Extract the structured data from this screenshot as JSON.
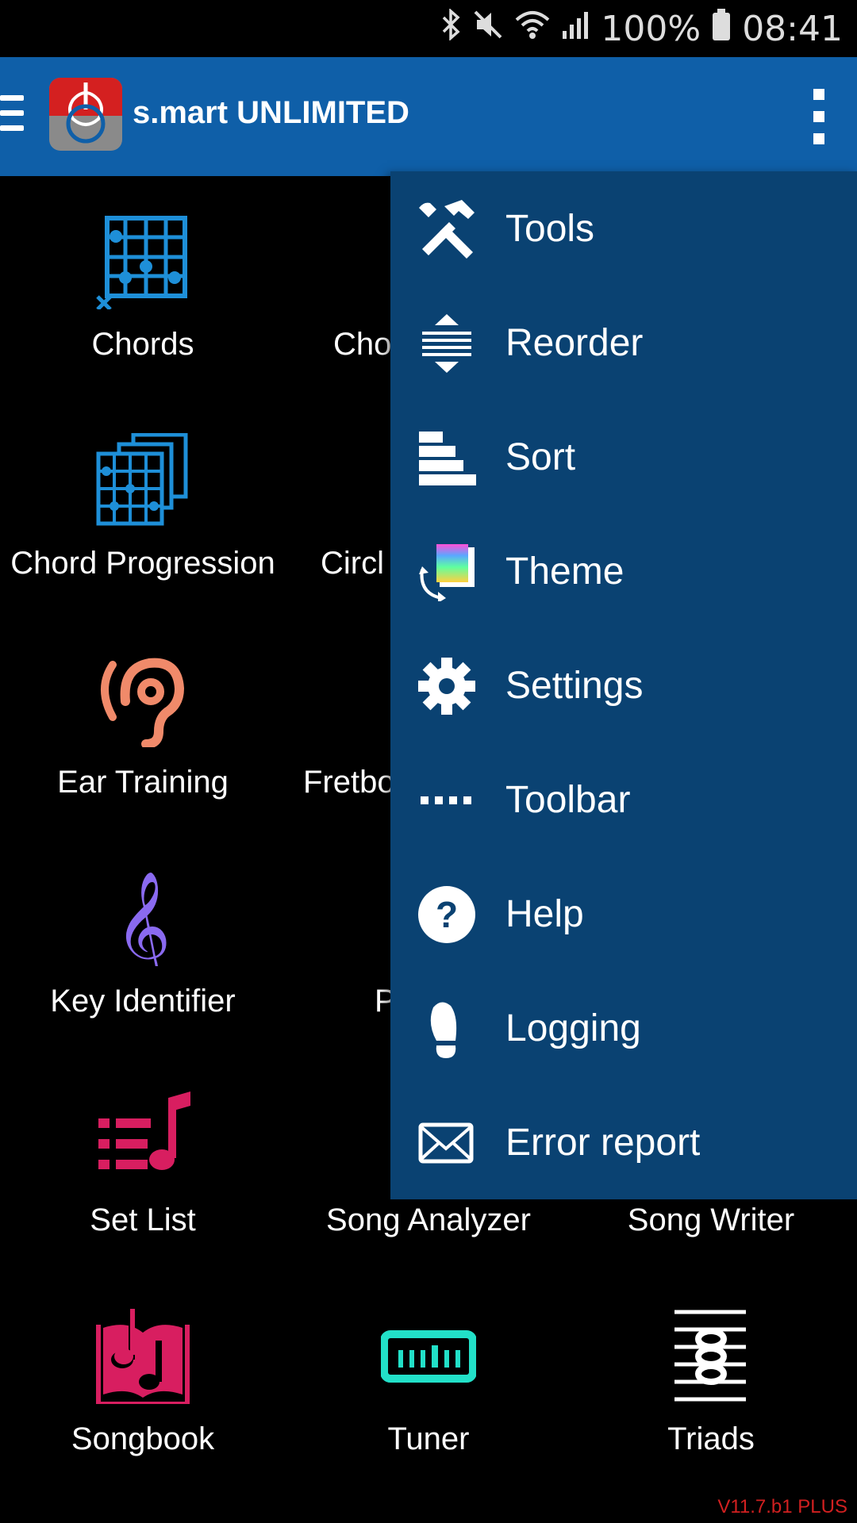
{
  "status_bar": {
    "battery": "100%",
    "time": "08:41",
    "icons": [
      "bluetooth-icon",
      "mute-icon",
      "wifi-icon",
      "signal-icon",
      "battery-icon"
    ]
  },
  "app_bar": {
    "title": "s.mart UNLIMITED",
    "brand_color": "#0f5fa8"
  },
  "tiles": [
    {
      "label": "Chords",
      "icon": "chord-grid-icon",
      "color": "#1e8fd8"
    },
    {
      "label": "Cho",
      "icon": "chord-grid-icon",
      "color": "#1e8fd8"
    },
    {
      "label": "",
      "icon": "",
      "color": ""
    },
    {
      "label": "Chord Progression",
      "icon": "chord-progression-icon",
      "color": "#1e8fd8"
    },
    {
      "label": "Circl",
      "icon": "circle-icon",
      "color": "#7a5ce0"
    },
    {
      "label": "",
      "icon": "",
      "color": ""
    },
    {
      "label": "Ear Training",
      "icon": "ear-icon",
      "color": "#f08a6a"
    },
    {
      "label": "Fretbo",
      "icon": "fretboard-icon",
      "color": "#1e8fd8"
    },
    {
      "label": "",
      "icon": "",
      "color": ""
    },
    {
      "label": "Key Identifier",
      "icon": "treble-clef-icon",
      "color": "#8a6af0"
    },
    {
      "label": "P",
      "icon": "generic-icon",
      "color": "#f0a040"
    },
    {
      "label": "",
      "icon": "",
      "color": ""
    },
    {
      "label": "Set List",
      "icon": "set-list-icon",
      "color": "#d81e60"
    },
    {
      "label": "Song Analyzer",
      "icon": "analyzer-icon",
      "color": "#7a5ce0"
    },
    {
      "label": "Song Writer",
      "icon": "",
      "color": ""
    },
    {
      "label": "Songbook",
      "icon": "songbook-icon",
      "color": "#d81e60"
    },
    {
      "label": "Tuner",
      "icon": "tuner-icon",
      "color": "#22e0c8"
    },
    {
      "label": "Triads",
      "icon": "triads-icon",
      "color": "#ffffff"
    }
  ],
  "menu": {
    "items": [
      {
        "label": "Tools",
        "icon": "tools-icon"
      },
      {
        "label": "Reorder",
        "icon": "reorder-icon"
      },
      {
        "label": "Sort",
        "icon": "sort-icon"
      },
      {
        "label": "Theme",
        "icon": "theme-icon"
      },
      {
        "label": "Settings",
        "icon": "gear-icon"
      },
      {
        "label": "Toolbar",
        "icon": "toolbar-dots-icon"
      },
      {
        "label": "Help",
        "icon": "help-icon"
      },
      {
        "label": "Logging",
        "icon": "footprint-icon"
      },
      {
        "label": "Error report",
        "icon": "envelope-icon"
      }
    ]
  },
  "version": "V11.7.b1 PLUS"
}
